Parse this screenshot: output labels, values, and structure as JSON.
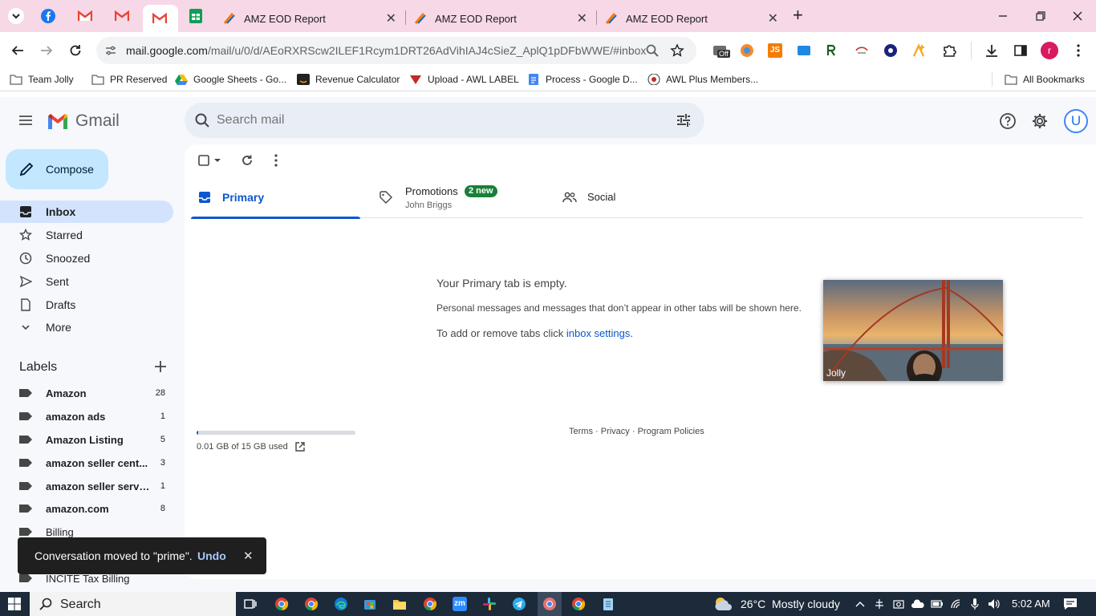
{
  "browser": {
    "tabs": [
      {
        "title": "AMZ EOD Report",
        "close": "✕"
      },
      {
        "title": "AMZ EOD Report",
        "close": "✕"
      },
      {
        "title": "AMZ EOD Report",
        "close": "✕"
      }
    ],
    "new_tab": "+",
    "url_host": "mail.google.com",
    "url_path": "/mail/u/0/d/AEoRXRScw2ILEF1Rcym1DRT26AdVihIAJ4cSieZ_AplQ1pDFbWWE/#inbox",
    "profile_initial": "r",
    "extension_off_badge": "Off",
    "extension_js_label": "JS"
  },
  "bookmarks": {
    "items": [
      "Team Jolly",
      "PR Reserved",
      "Google Sheets - Go...",
      "Revenue Calculator",
      "Upload - AWL LABEL",
      "Process - Google D...",
      "AWL Plus Members..."
    ],
    "all": "All Bookmarks"
  },
  "gmail": {
    "logo": "Gmail",
    "search_placeholder": "Search mail",
    "avatar_initial": "U",
    "compose": "Compose",
    "nav": [
      {
        "label": "Inbox",
        "icon": "inbox-icon"
      },
      {
        "label": "Starred",
        "icon": "star-icon"
      },
      {
        "label": "Snoozed",
        "icon": "clock-icon"
      },
      {
        "label": "Sent",
        "icon": "send-icon"
      },
      {
        "label": "Drafts",
        "icon": "draft-icon"
      },
      {
        "label": "More",
        "icon": "chevron-down-icon"
      }
    ],
    "labels_heading": "Labels",
    "labels": [
      {
        "name": "Amazon",
        "count": "28"
      },
      {
        "name": "amazon ads",
        "count": "1"
      },
      {
        "name": "Amazon Listing",
        "count": "5"
      },
      {
        "name": "amazon seller cent...",
        "count": "3"
      },
      {
        "name": "amazon seller servi...",
        "count": "1"
      },
      {
        "name": "amazon.com",
        "count": "8"
      },
      {
        "name": "Billing",
        "count": ""
      },
      {
        "name": "INCITE Tax Billing",
        "count": ""
      }
    ],
    "tabs": {
      "primary": "Primary",
      "promotions": "Promotions",
      "promotions_badge": "2 new",
      "promotions_sender": "John Briggs",
      "social": "Social"
    },
    "empty": {
      "title": "Your Primary tab is empty.",
      "line1": "Personal messages and messages that don’t appear in other tabs will be shown here.",
      "line2_prefix": "To add or remove tabs click ",
      "line2_link": "inbox settings",
      "line2_suffix": "."
    },
    "storage": {
      "text": "0.01 GB of 15 GB used",
      "fraction": 0.001
    },
    "footer": {
      "terms": "Terms",
      "sep": " · ",
      "privacy": "Privacy",
      "policies": "Program Policies"
    },
    "video_name": "Jolly",
    "toast": {
      "text": "Conversation moved to \"prime\".",
      "undo": "Undo",
      "close": "✕"
    }
  },
  "taskbar": {
    "search": "Search",
    "weather": "26°C  Mostly cloudy",
    "time": "5:02 AM",
    "zoom_label": "zm"
  },
  "colors": {
    "tabstrip": "#f6d8e6",
    "gmail_bg": "#f6f8fc",
    "compose": "#c2e7ff",
    "nav_active": "#d3e3fd",
    "primary_blue": "#0b57d0",
    "badge_green": "#188038",
    "taskbar": "#1c2a3a"
  }
}
